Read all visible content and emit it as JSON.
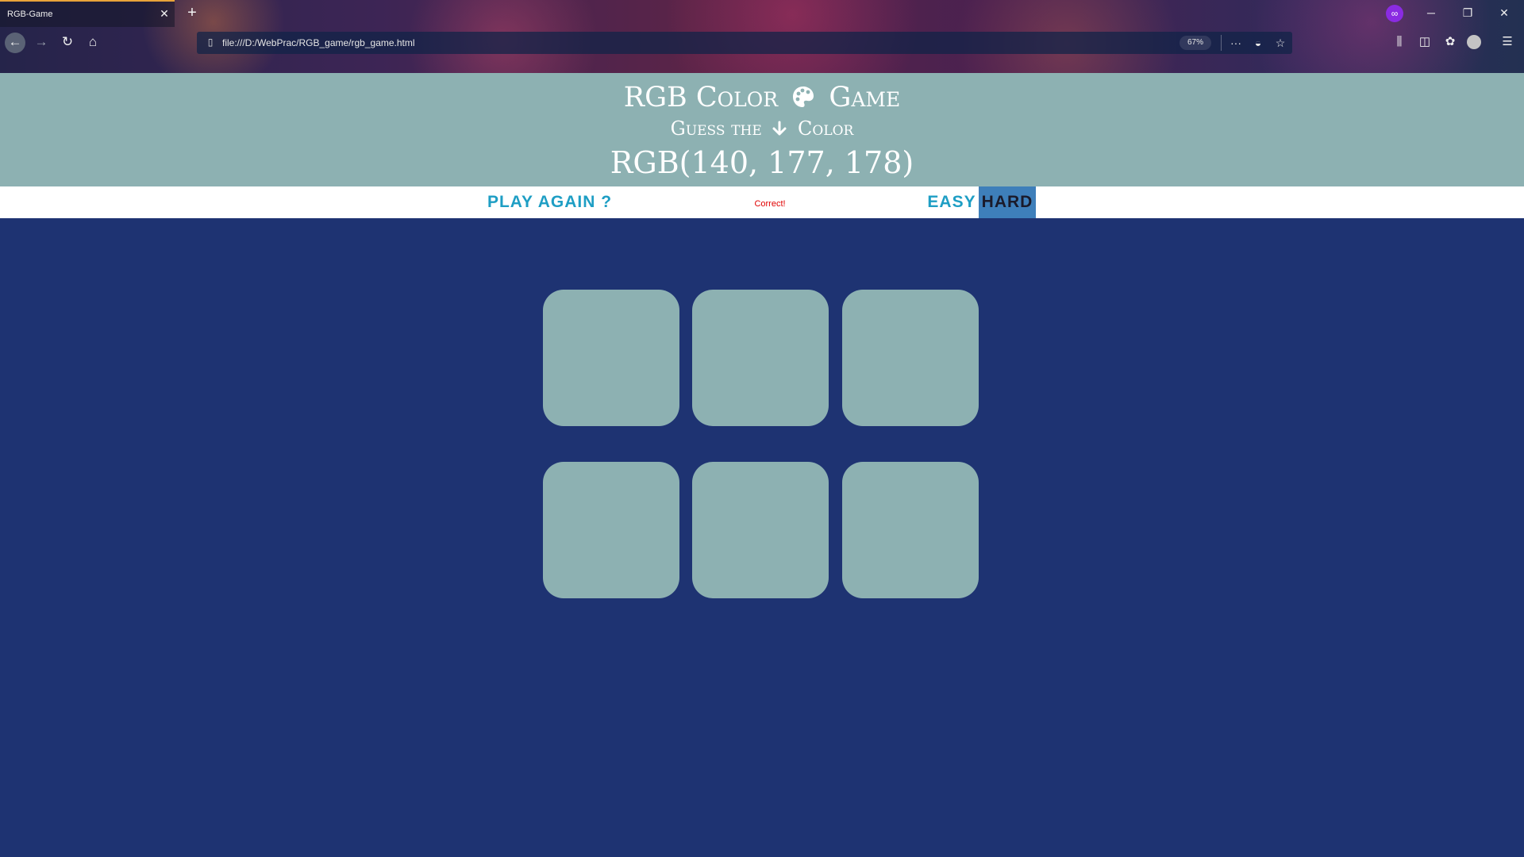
{
  "browser": {
    "tab_title": "RGB-Game",
    "url": "file:///D:/WebPrac/RGB_game/rgb_game.html",
    "zoom": "67%"
  },
  "game": {
    "title_part1": "RGB Color",
    "title_part2": "Game",
    "subtitle_part1": "Guess the",
    "subtitle_part2": "Color",
    "rgb_display": "RGB(140, 177, 178)",
    "play_again_label": "PLAY AGAIN ?",
    "message": "Correct!",
    "easy_label": "EASY",
    "hard_label": "HARD",
    "selected_mode": "HARD",
    "square_color": "#8db1b2",
    "background_color": "#1e3372",
    "header_color": "#8db1b2",
    "accent_color": "#1e9ec4",
    "selected_mode_color": "#3e7fba",
    "message_color": "#e00000"
  },
  "squares": [
    {
      "color": "#8db1b2"
    },
    {
      "color": "#8db1b2"
    },
    {
      "color": "#8db1b2"
    },
    {
      "color": "#8db1b2"
    },
    {
      "color": "#8db1b2"
    },
    {
      "color": "#8db1b2"
    }
  ]
}
